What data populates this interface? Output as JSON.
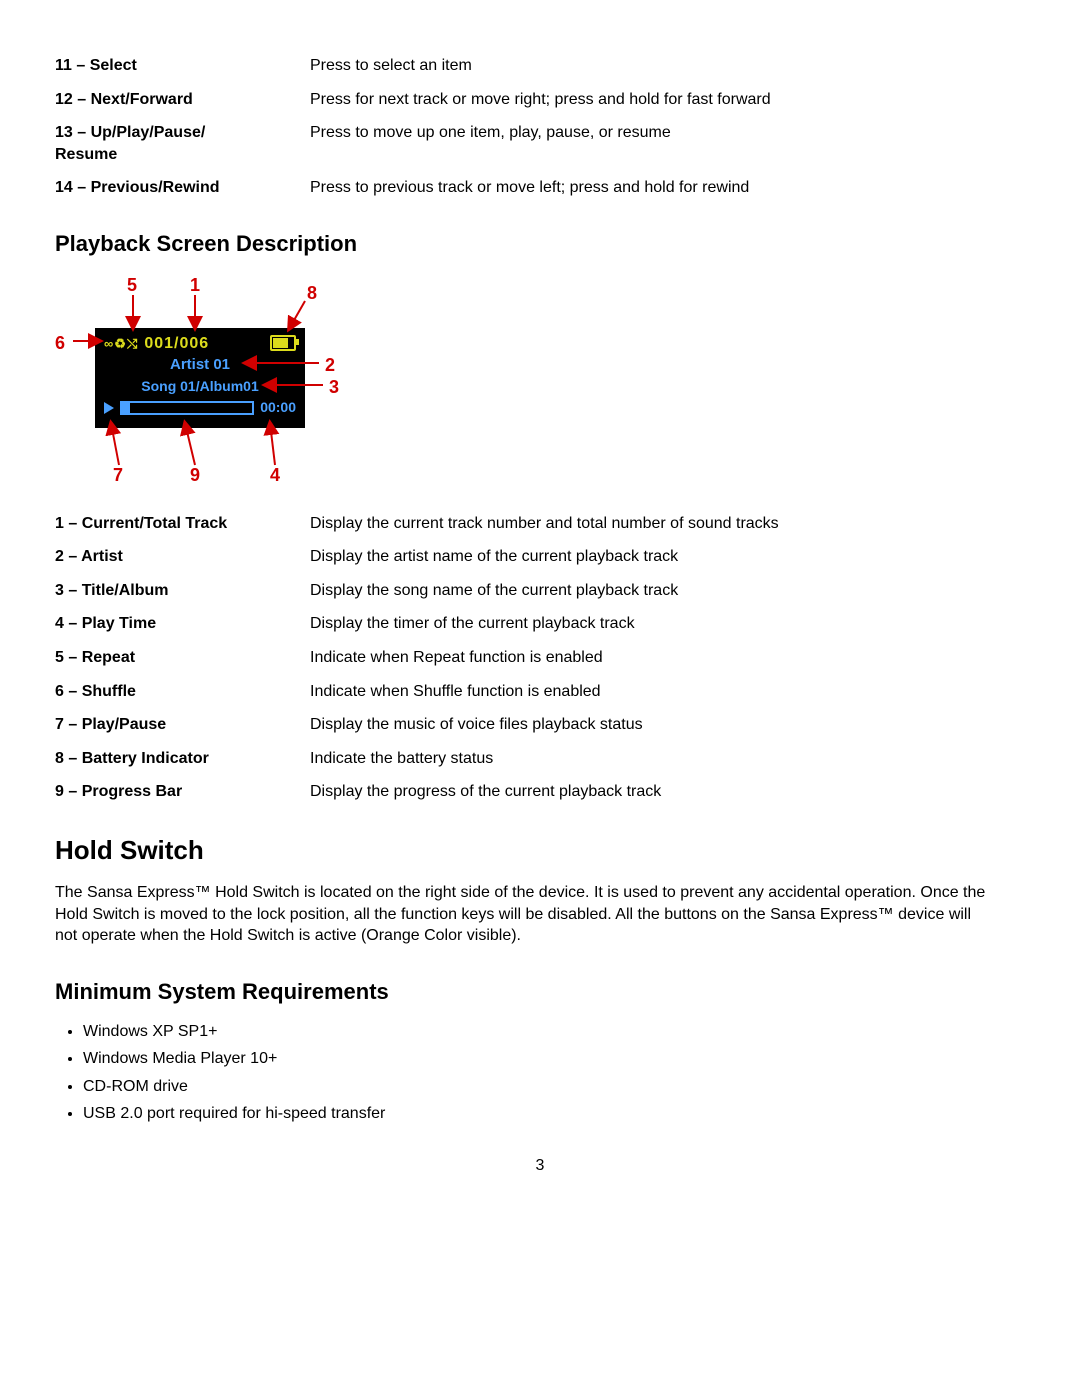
{
  "controls": [
    {
      "label": "11 – Select",
      "desc": "Press to select an item"
    },
    {
      "label": "12 – Next/Forward",
      "desc": "Press for next track or move right; press and hold for fast forward"
    },
    {
      "label": "13 – Up/Play/Pause/ Resume",
      "desc": "Press to move up one item, play, pause, or resume"
    },
    {
      "label": "14 – Previous/Rewind",
      "desc": "Press to previous track or move left; press and hold for rewind"
    }
  ],
  "playback_heading": "Playback Screen Description",
  "diagram": {
    "callouts": {
      "n1": "1",
      "n2": "2",
      "n3": "3",
      "n4": "4",
      "n5": "5",
      "n6": "6",
      "n7": "7",
      "n8": "8",
      "n9": "9"
    },
    "track": "001/006",
    "artist": "Artist 01",
    "title": "Song 01/Album01",
    "time": "00:00",
    "icons": "∞♻⤭"
  },
  "playback": [
    {
      "label": "1 – Current/Total Track",
      "desc": "Display the current track number and total number of sound tracks"
    },
    {
      "label": "2 – Artist",
      "desc": "Display the artist name of the current playback track"
    },
    {
      "label": "3 – Title/Album",
      "desc": "Display the song name of the current playback track"
    },
    {
      "label": "4 – Play Time",
      "desc": "Display the timer of the current playback track"
    },
    {
      "label": "5 – Repeat",
      "desc": "Indicate when Repeat function is enabled"
    },
    {
      "label": "6 – Shuffle",
      "desc": "Indicate when Shuffle function is enabled"
    },
    {
      "label": "7 – Play/Pause",
      "desc": "Display the music of voice files playback status"
    },
    {
      "label": "8 – Battery Indicator",
      "desc": "Indicate the battery status"
    },
    {
      "label": "9 – Progress Bar",
      "desc": "Display the progress of the current playback track"
    }
  ],
  "hold_heading": "Hold Switch",
  "hold_text": "The Sansa Express™ Hold Switch is located on the right side of the device.  It is used to prevent any accidental operation.  Once the Hold Switch is moved to the lock position, all the function keys will be disabled.  All the buttons on the Sansa Express™ device will not operate when the Hold Switch is active (Orange Color visible).",
  "req_heading": "Minimum System Requirements",
  "requirements": [
    "Windows XP SP1+",
    "Windows Media Player 10+",
    "CD-ROM drive",
    "USB 2.0 port required for hi-speed transfer"
  ],
  "page_number": "3"
}
